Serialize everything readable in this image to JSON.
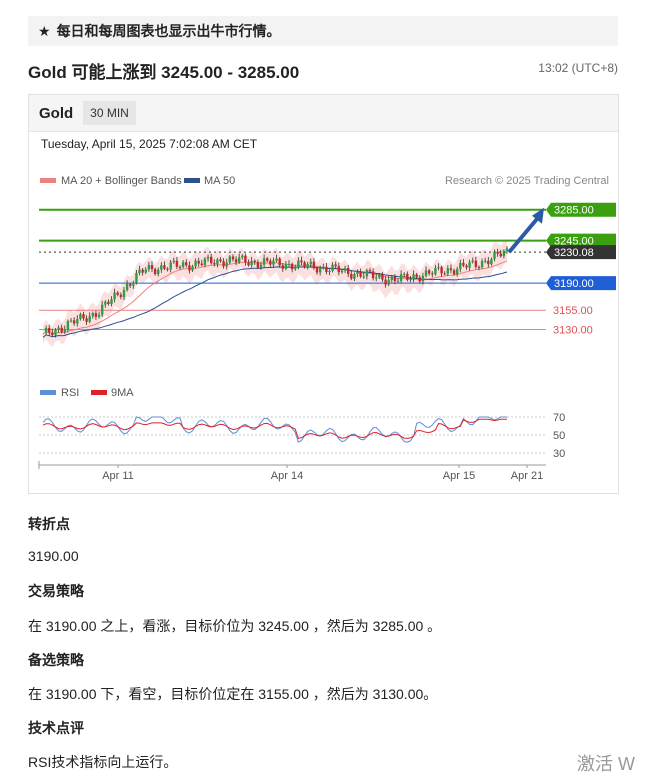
{
  "banner": {
    "star_icon": "star-icon",
    "text": "每日和每周图表也显示出牛市行情。"
  },
  "article": {
    "title": "Gold 可能上涨到 3245.00 - 3285.00",
    "time": "13:02 (UTC+8)"
  },
  "chart_card": {
    "symbol": "Gold",
    "timeframe": "30 MIN",
    "datestamp": "Tuesday, April 15, 2025 7:02:08 AM CET",
    "legend": [
      {
        "label": "MA 20 + Bollinger Bands",
        "color": "#f08080"
      },
      {
        "label": "MA 50",
        "color": "#2f4f8f"
      }
    ],
    "credit": "Research © 2025 Trading Central",
    "rsi_legend": [
      {
        "label": "RSI",
        "color": "#5b8fd6"
      },
      {
        "label": "9MA",
        "color": "#e0202a"
      }
    ]
  },
  "chart_data": {
    "type": "candlestick",
    "price_axis": {
      "min": 3110,
      "max": 3295
    },
    "x_labels": [
      "Apr 11",
      "Apr 14",
      "Apr 15",
      "Apr 21"
    ],
    "levels": [
      {
        "value": 3285.0,
        "label": "3285.00",
        "kind": "target",
        "color": "#3aa00f"
      },
      {
        "value": 3245.0,
        "label": "3245.00",
        "kind": "target",
        "color": "#3aa00f"
      },
      {
        "value": 3230.08,
        "label": "3230.08",
        "kind": "last",
        "color": "#333333"
      },
      {
        "value": 3190.0,
        "label": "3190.00",
        "kind": "pivot",
        "color": "#1f5fd6"
      },
      {
        "value": 3155.0,
        "label": "3155.00",
        "kind": "support",
        "color": "#e05050"
      },
      {
        "value": 3130.0,
        "label": "3130.00",
        "kind": "support",
        "color": "#e05050"
      }
    ],
    "rsi_axis": {
      "ticks": [
        "70",
        "50",
        "30"
      ]
    },
    "trend_arrow": {
      "from_value": 3230,
      "to_value": 3285,
      "color": "#2a5aa8"
    }
  },
  "sections": [
    {
      "heading": "转折点",
      "body": "3190.00"
    },
    {
      "heading": "交易策略",
      "body": "在 3190.00 之上，看涨，目标价位为 3245.00 ，然后为 3285.00 。"
    },
    {
      "heading": "备选策略",
      "body": "在 3190.00 下，看空，目标价位定在 3155.00 ，然后为 3130.00。"
    },
    {
      "heading": "技术点评",
      "body": "RSI技术指标向上运行。"
    }
  ],
  "watermark": "激活 W"
}
